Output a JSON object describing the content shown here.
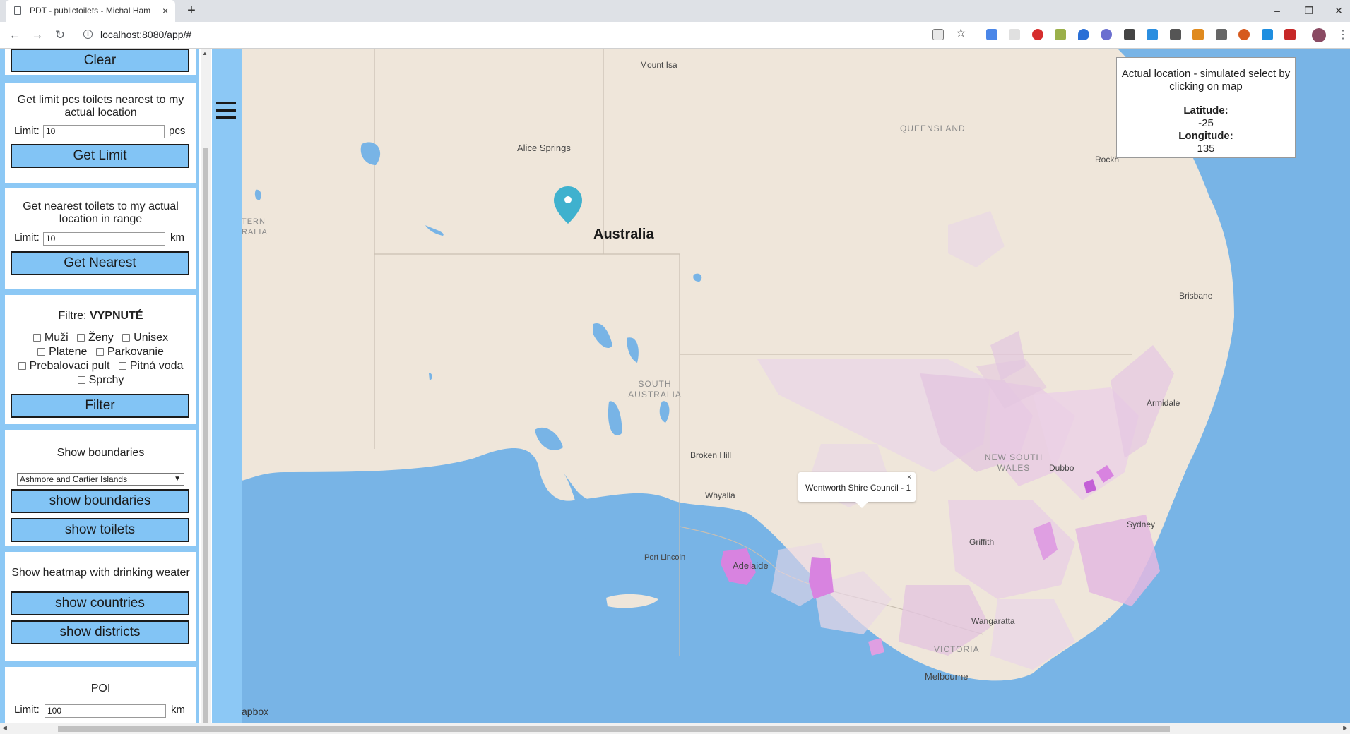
{
  "browser": {
    "tab_title": "PDT - publictoilets - Michal Ham",
    "tab_close": "×",
    "new_tab": "+",
    "url": "localhost:8080/app/#",
    "minimize": "–",
    "restore": "❐",
    "close": "✕",
    "back": "←",
    "forward": "→",
    "reload": "↻",
    "info": "i",
    "star": "☆",
    "menu": "⋮",
    "extensions": [
      "translate-icon",
      "air-icon",
      "adblock-icon",
      "js-icon",
      "drop-icon",
      "circle-icon",
      "box-icon",
      "blue-square-icon",
      "grid-icon",
      "download-icon",
      "puzzle-icon",
      "shield-icon",
      "cast-icon",
      "mega-icon"
    ]
  },
  "sidebar": {
    "clear_button": "Clear",
    "limit_panel": {
      "text": "Get limit pcs toilets nearest to my actual location",
      "limit_label": "Limit:",
      "limit_value": "10",
      "unit": "pcs",
      "button": "Get Limit"
    },
    "nearest_panel": {
      "text": "Get nearest toilets to my actual location in range",
      "limit_label": "Limit:",
      "limit_value": "10",
      "unit": "km",
      "button": "Get Nearest"
    },
    "filter_panel": {
      "label": "Filtre:",
      "state": "VYPNUTÉ",
      "options": [
        "Muži",
        "Ženy",
        "Unisex",
        "Platene",
        "Parkovanie",
        "Prebalovaci pult",
        "Pitná voda",
        "Sprchy"
      ],
      "button": "Filter"
    },
    "boundaries_panel": {
      "title": "Show boundaries",
      "select_value": "Ashmore and Cartier Islands",
      "select_arrow": "▼",
      "button_boundaries": "show boundaries",
      "button_toilets": "show toilets"
    },
    "heatmap_panel": {
      "title": "Show heatmap with drinking weater",
      "button_countries": "show countries",
      "button_districts": "show districts"
    },
    "poi_panel": {
      "title": "POI",
      "limit_label": "Limit:",
      "limit_value": "100",
      "unit": "km"
    }
  },
  "map": {
    "country": "Australia",
    "cities": [
      "Mount Isa",
      "Alice Springs",
      "Rockh",
      "Brisbane",
      "Armidale",
      "Dubbo",
      "Broken Hill",
      "Whyalla",
      "Griffith",
      "Sydney",
      "Port Lincoln",
      "Adelaide",
      "Wangaratta",
      "Melbourne"
    ],
    "states": {
      "queensland": "QUEENSLAND",
      "sa_1": "SOUTH",
      "sa_2": "AUSTRALIA",
      "nsw_1": "NEW SOUTH",
      "nsw_2": "WALES",
      "victoria": "VICTORIA",
      "wa_1": "TERN",
      "wa_2": "RALIA"
    },
    "popup": {
      "text": "Wentworth Shire Council - 1",
      "close": "×"
    },
    "attribution": "apbox",
    "location_box": {
      "line": "Actual location - simulated select by clicking on map",
      "lat_label": "Latitude:",
      "lat_value": "-25",
      "lon_label": "Longitude:",
      "lon_value": "135"
    },
    "colors": {
      "water": "#78b4e6",
      "land": "#efe6da",
      "border": "#c9bfb2",
      "choropleth_light": "#ead7e6",
      "choropleth_mid": "#e3b9e1",
      "choropleth_strong": "#d883e0",
      "marker": "#3fb1ce"
    }
  }
}
